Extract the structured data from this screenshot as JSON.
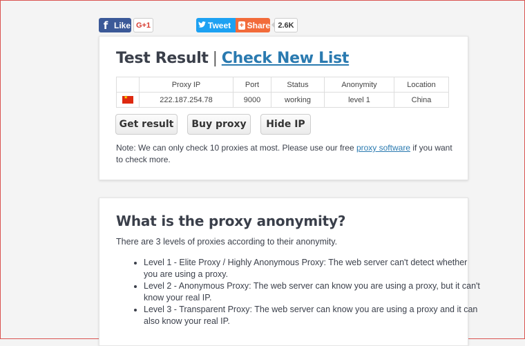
{
  "social": {
    "facebook_icon": "f",
    "facebook_label": "Like",
    "gplus_label": "G+1",
    "twitter_icon": "bird-icon",
    "twitter_label": "Tweet",
    "share_icon": "+",
    "share_label": "Share",
    "share_count": "2.6K"
  },
  "result": {
    "title": "Test Result",
    "separator": "|",
    "check_link": "Check New List",
    "table": {
      "headers": [
        "",
        "Proxy IP",
        "Port",
        "Status",
        "Anonymity",
        "Location"
      ],
      "rows": [
        {
          "flag": "china-flag-icon",
          "ip": "222.187.254.78",
          "port": "9000",
          "status": "working",
          "anonymity": "level 1",
          "location": "China"
        }
      ]
    },
    "buttons": {
      "get_result": "Get result",
      "buy_proxy": "Buy proxy",
      "hide_ip": "Hide IP"
    },
    "note_before": "Note: We can only check 10 proxies at most. Please use our free ",
    "note_link": "proxy software",
    "note_after": " if you want to check more."
  },
  "anonymity": {
    "title": "What is the proxy anonymity?",
    "intro": "There are 3 levels of proxies according to their anonymity.",
    "levels": [
      "Level 1 - Elite Proxy / Highly Anonymous Proxy: The web server can't detect whether you are using a proxy.",
      "Level 2 - Anonymous Proxy: The web server can know you are using a proxy, but it can't know your real IP.",
      "Level 3 - Transparent Proxy: The web server can know you are using a proxy and it can also know your real IP."
    ]
  },
  "colors": {
    "link": "#2a7ab0",
    "facebook": "#3b5998",
    "twitter": "#1da1f2",
    "share": "#f26b3a",
    "page_border": "#d9534f"
  }
}
